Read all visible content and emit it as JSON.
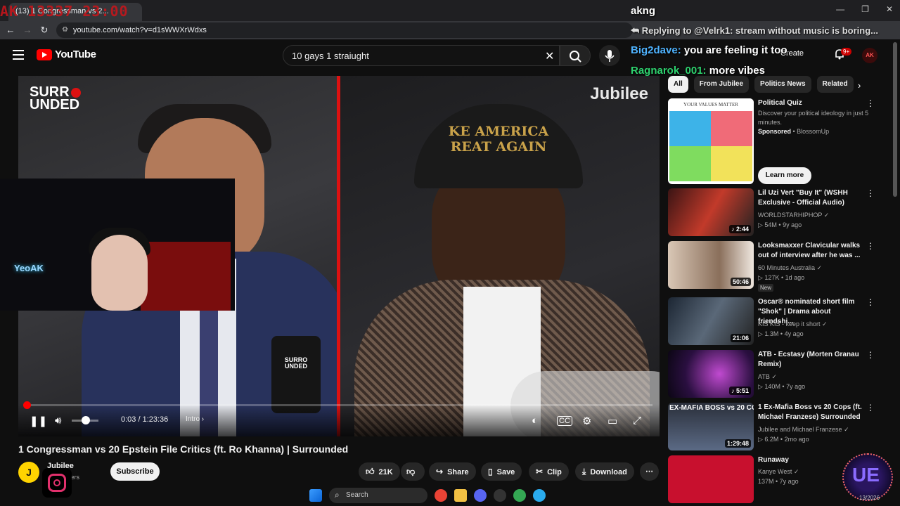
{
  "browser": {
    "tab_title": "(13) 1 Congressman vs 2...",
    "tab_overlay": "AK 13337 23:00",
    "url": "youtube.com/watch?v=d1sWWXrWdxs",
    "window_controls": [
      "—",
      "❐",
      "✕"
    ]
  },
  "header": {
    "logo": "YouTube",
    "search_value": "10 gays 1 straiught",
    "create_label": "Create",
    "notif_count": "9+",
    "avatar_text": "AK"
  },
  "chat": {
    "top_line": "akng",
    "reply_line": "Replying to @Velrk1: stream without music is boring...",
    "msg1_user": "Big2dave:",
    "msg1_text": " you are feeling it too",
    "msg2_user": "Ragnarok_001:",
    "msg2_text": " more vibes"
  },
  "player": {
    "watermark_left_1": "SURR",
    "watermark_left_2": "UNDED",
    "watermark_right": "Jubilee",
    "cap_text_1": "KE AMERICA",
    "cap_text_2": "REAT AGAIN",
    "mic_label": "SURRO UNDED",
    "time": "0:03 / 1:23:36",
    "chapter": "Intro",
    "progress": 0.001,
    "webcam_sign": "YeoAK"
  },
  "video": {
    "title": "1 Congressman vs 20 Epstein File Critics (ft. Ro Khanna) | Surrounded",
    "channel_avatar": "J",
    "channel": "Jubilee",
    "subscribers": "subscribers",
    "subscribe_label": "Subscribe",
    "likes": "21K",
    "share": "Share",
    "save": "Save",
    "clip": "Clip",
    "download": "Download"
  },
  "sidebar": {
    "chips": [
      "All",
      "From Jubilee",
      "Politics News",
      "Related"
    ],
    "ad": {
      "title": "Political Quiz",
      "description": "Discover your political ideology in just 5 minutes.",
      "sponsored": "Sponsored",
      "advertiser": "BlossomUp",
      "cta": "Learn more",
      "thumb_header": "YOUR VALUES MATTER"
    },
    "videos": [
      {
        "title": "Lil Uzi Vert \"Buy It\" (WSHH Exclusive - Official Audio)",
        "channel": "WORLDSTARHIPHOP",
        "meta": "54M • 9y ago",
        "duration": "2:44"
      },
      {
        "title": "Looksmaxxer Clavicular walks out of interview after he was ...",
        "channel": "60 Minutes Australia",
        "meta": "127K • 1d ago",
        "duration": "50:46",
        "badge": "New"
      },
      {
        "title": "Oscar® nominated short film \"Shok\" | Drama about friendshi...",
        "channel": "KIS KIS - keep it short",
        "meta": "1.3M • 4y ago",
        "duration": "21:06"
      },
      {
        "title": "ATB - Ecstasy (Morten Granau Remix)",
        "channel": "ATB",
        "meta": "140M • 7y ago",
        "duration": "5:51"
      },
      {
        "title": "1 Ex-Mafia Boss vs 20 Cops (ft. Michael Franzese) Surrounded",
        "channel": "Jubilee and Michael Franzese",
        "meta": "6.2M • 2mo ago",
        "duration": "1:29:48",
        "thumb_text": "EX-MAFIA BOSS vs 20 COPS"
      },
      {
        "title": "Runaway",
        "channel": "Kanye West",
        "meta": "137M • 7y ago",
        "duration": ""
      }
    ]
  },
  "taskbar": {
    "search": "Search",
    "date": "13/2026"
  },
  "emote": "UE"
}
